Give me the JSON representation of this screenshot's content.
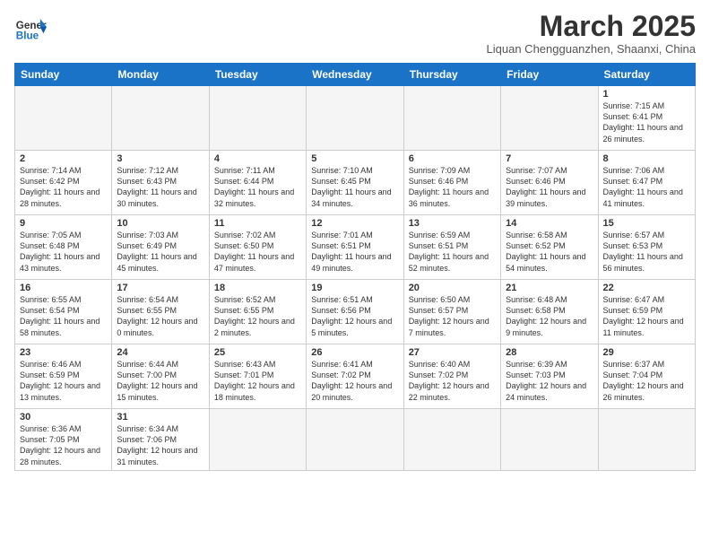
{
  "header": {
    "logo_general": "General",
    "logo_blue": "Blue",
    "month": "March 2025",
    "location": "Liquan Chengguanzhen, Shaanxi, China"
  },
  "days_of_week": [
    "Sunday",
    "Monday",
    "Tuesday",
    "Wednesday",
    "Thursday",
    "Friday",
    "Saturday"
  ],
  "weeks": [
    [
      {
        "day": "",
        "info": ""
      },
      {
        "day": "",
        "info": ""
      },
      {
        "day": "",
        "info": ""
      },
      {
        "day": "",
        "info": ""
      },
      {
        "day": "",
        "info": ""
      },
      {
        "day": "",
        "info": ""
      },
      {
        "day": "1",
        "info": "Sunrise: 7:15 AM\nSunset: 6:41 PM\nDaylight: 11 hours\nand 26 minutes."
      }
    ],
    [
      {
        "day": "2",
        "info": "Sunrise: 7:14 AM\nSunset: 6:42 PM\nDaylight: 11 hours\nand 28 minutes."
      },
      {
        "day": "3",
        "info": "Sunrise: 7:12 AM\nSunset: 6:43 PM\nDaylight: 11 hours\nand 30 minutes."
      },
      {
        "day": "4",
        "info": "Sunrise: 7:11 AM\nSunset: 6:44 PM\nDaylight: 11 hours\nand 32 minutes."
      },
      {
        "day": "5",
        "info": "Sunrise: 7:10 AM\nSunset: 6:45 PM\nDaylight: 11 hours\nand 34 minutes."
      },
      {
        "day": "6",
        "info": "Sunrise: 7:09 AM\nSunset: 6:46 PM\nDaylight: 11 hours\nand 36 minutes."
      },
      {
        "day": "7",
        "info": "Sunrise: 7:07 AM\nSunset: 6:46 PM\nDaylight: 11 hours\nand 39 minutes."
      },
      {
        "day": "8",
        "info": "Sunrise: 7:06 AM\nSunset: 6:47 PM\nDaylight: 11 hours\nand 41 minutes."
      }
    ],
    [
      {
        "day": "9",
        "info": "Sunrise: 7:05 AM\nSunset: 6:48 PM\nDaylight: 11 hours\nand 43 minutes."
      },
      {
        "day": "10",
        "info": "Sunrise: 7:03 AM\nSunset: 6:49 PM\nDaylight: 11 hours\nand 45 minutes."
      },
      {
        "day": "11",
        "info": "Sunrise: 7:02 AM\nSunset: 6:50 PM\nDaylight: 11 hours\nand 47 minutes."
      },
      {
        "day": "12",
        "info": "Sunrise: 7:01 AM\nSunset: 6:51 PM\nDaylight: 11 hours\nand 49 minutes."
      },
      {
        "day": "13",
        "info": "Sunrise: 6:59 AM\nSunset: 6:51 PM\nDaylight: 11 hours\nand 52 minutes."
      },
      {
        "day": "14",
        "info": "Sunrise: 6:58 AM\nSunset: 6:52 PM\nDaylight: 11 hours\nand 54 minutes."
      },
      {
        "day": "15",
        "info": "Sunrise: 6:57 AM\nSunset: 6:53 PM\nDaylight: 11 hours\nand 56 minutes."
      }
    ],
    [
      {
        "day": "16",
        "info": "Sunrise: 6:55 AM\nSunset: 6:54 PM\nDaylight: 11 hours\nand 58 minutes."
      },
      {
        "day": "17",
        "info": "Sunrise: 6:54 AM\nSunset: 6:55 PM\nDaylight: 12 hours\nand 0 minutes."
      },
      {
        "day": "18",
        "info": "Sunrise: 6:52 AM\nSunset: 6:55 PM\nDaylight: 12 hours\nand 2 minutes."
      },
      {
        "day": "19",
        "info": "Sunrise: 6:51 AM\nSunset: 6:56 PM\nDaylight: 12 hours\nand 5 minutes."
      },
      {
        "day": "20",
        "info": "Sunrise: 6:50 AM\nSunset: 6:57 PM\nDaylight: 12 hours\nand 7 minutes."
      },
      {
        "day": "21",
        "info": "Sunrise: 6:48 AM\nSunset: 6:58 PM\nDaylight: 12 hours\nand 9 minutes."
      },
      {
        "day": "22",
        "info": "Sunrise: 6:47 AM\nSunset: 6:59 PM\nDaylight: 12 hours\nand 11 minutes."
      }
    ],
    [
      {
        "day": "23",
        "info": "Sunrise: 6:46 AM\nSunset: 6:59 PM\nDaylight: 12 hours\nand 13 minutes."
      },
      {
        "day": "24",
        "info": "Sunrise: 6:44 AM\nSunset: 7:00 PM\nDaylight: 12 hours\nand 15 minutes."
      },
      {
        "day": "25",
        "info": "Sunrise: 6:43 AM\nSunset: 7:01 PM\nDaylight: 12 hours\nand 18 minutes."
      },
      {
        "day": "26",
        "info": "Sunrise: 6:41 AM\nSunset: 7:02 PM\nDaylight: 12 hours\nand 20 minutes."
      },
      {
        "day": "27",
        "info": "Sunrise: 6:40 AM\nSunset: 7:02 PM\nDaylight: 12 hours\nand 22 minutes."
      },
      {
        "day": "28",
        "info": "Sunrise: 6:39 AM\nSunset: 7:03 PM\nDaylight: 12 hours\nand 24 minutes."
      },
      {
        "day": "29",
        "info": "Sunrise: 6:37 AM\nSunset: 7:04 PM\nDaylight: 12 hours\nand 26 minutes."
      }
    ],
    [
      {
        "day": "30",
        "info": "Sunrise: 6:36 AM\nSunset: 7:05 PM\nDaylight: 12 hours\nand 28 minutes."
      },
      {
        "day": "31",
        "info": "Sunrise: 6:34 AM\nSunset: 7:06 PM\nDaylight: 12 hours\nand 31 minutes."
      },
      {
        "day": "",
        "info": ""
      },
      {
        "day": "",
        "info": ""
      },
      {
        "day": "",
        "info": ""
      },
      {
        "day": "",
        "info": ""
      },
      {
        "day": "",
        "info": ""
      }
    ]
  ]
}
